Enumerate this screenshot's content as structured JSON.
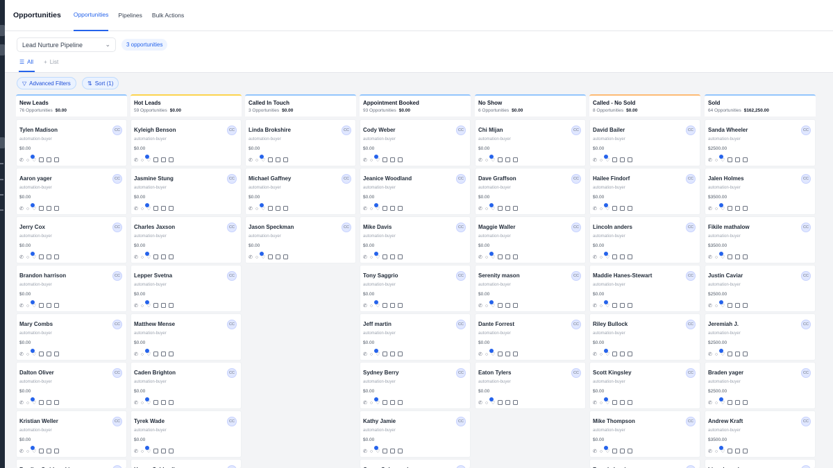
{
  "header": {
    "title": "Opportunities",
    "tabs": [
      {
        "label": "Opportunities",
        "active": true
      },
      {
        "label": "Pipelines",
        "active": false
      },
      {
        "label": "Bulk Actions",
        "active": false
      }
    ]
  },
  "toolbar": {
    "pipeline_select": "Lead Nurture Pipeline",
    "opportunities_count": "3 opportunities",
    "view_tabs": [
      {
        "label": "All",
        "icon": "list-icon",
        "active": true
      },
      {
        "label": "List",
        "icon": "plus-icon",
        "active": false
      }
    ]
  },
  "filters": {
    "advanced_filters": "Advanced Filters",
    "sort": "Sort (1)"
  },
  "card_common": {
    "tag": "automation-buyer",
    "avatar": "CC",
    "action_icons": [
      "phone-icon",
      "chat-icon",
      "tag-icon",
      "document-icon",
      "checkbox-icon",
      "calendar-icon"
    ]
  },
  "columns": [
    {
      "title": "New Leads",
      "count": "76 Opportunities",
      "amount": "$0.00",
      "accent": "#93c5fd",
      "cards": [
        {
          "name": "Tylen Madison",
          "value": "$0.00"
        },
        {
          "name": "Aaron yager",
          "value": "$0.00"
        },
        {
          "name": "Jerry Cox",
          "value": "$0.00"
        },
        {
          "name": "Brandon harrison",
          "value": "$0.00"
        },
        {
          "name": "Mary Combs",
          "value": "$0.00"
        },
        {
          "name": "Dalton Oliver",
          "value": "$0.00"
        },
        {
          "name": "Kristian Weller",
          "value": "$0.00"
        },
        {
          "name": "Bradley Swidowski",
          "value": ""
        }
      ]
    },
    {
      "title": "Hot Leads",
      "count": "59 Opportunities",
      "amount": "$0.00",
      "accent": "#fcd34d",
      "cards": [
        {
          "name": "Kyleigh Benson",
          "value": "$0.00"
        },
        {
          "name": "Jasmine Stung",
          "value": "$0.00"
        },
        {
          "name": "Charles Jaxson",
          "value": "$0.00"
        },
        {
          "name": "Lepper Svetna",
          "value": "$0.00"
        },
        {
          "name": "Matthew Mense",
          "value": "$0.00"
        },
        {
          "name": "Caden Brighton",
          "value": "$0.00"
        },
        {
          "name": "Tyrek Wade",
          "value": "$0.00"
        },
        {
          "name": "Hosea Caldwell",
          "value": ""
        }
      ]
    },
    {
      "title": "Called In Touch",
      "count": "3 Opportunities",
      "amount": "$0.00",
      "accent": "#93c5fd",
      "cards": [
        {
          "name": "Linda Brokshire",
          "value": "$0.00"
        },
        {
          "name": "Michael Gaffney",
          "value": "$0.00"
        },
        {
          "name": "Jason Speckman",
          "value": "$0.00"
        }
      ]
    },
    {
      "title": "Appointment Booked",
      "count": "93 Opportunities",
      "amount": "$0.00",
      "accent": "#93c5fd",
      "cards": [
        {
          "name": "Cody Weber",
          "value": "$0.00"
        },
        {
          "name": "Jeanice Woodland",
          "value": "$0.00"
        },
        {
          "name": "Mike Davis",
          "value": "$0.00"
        },
        {
          "name": "Tony Saggrio",
          "value": "$0.00"
        },
        {
          "name": "Jeff martin",
          "value": "$0.00"
        },
        {
          "name": "Sydney Berry",
          "value": "$0.00"
        },
        {
          "name": "Kathy Jamie",
          "value": "$0.00"
        },
        {
          "name": "Casey Colagrande",
          "value": ""
        }
      ]
    },
    {
      "title": "No Show",
      "count": "6 Opportunities",
      "amount": "$0.00",
      "accent": "#93c5fd",
      "cards": [
        {
          "name": "Chi Mijan",
          "value": "$0.00"
        },
        {
          "name": "Dave Graffson",
          "value": "$0.00"
        },
        {
          "name": "Maggie Waller",
          "value": "$0.00"
        },
        {
          "name": "Serenity mason",
          "value": "$0.00"
        },
        {
          "name": "Dante Forrest",
          "value": "$0.00"
        },
        {
          "name": "Eaton Tylers",
          "value": "$0.00"
        }
      ]
    },
    {
      "title": "Called - No Sold",
      "count": "8 Opportunities",
      "amount": "$0.00",
      "accent": "#fdba74",
      "cards": [
        {
          "name": "David Bailer",
          "value": "$0.00"
        },
        {
          "name": "Hailee Findorf",
          "value": "$0.00"
        },
        {
          "name": "Lincoln anders",
          "value": "$0.00"
        },
        {
          "name": "Maddie Hanes-Stewart",
          "value": "$0.00"
        },
        {
          "name": "Riley Bullock",
          "value": "$0.00"
        },
        {
          "name": "Scott Kingsley",
          "value": "$0.00"
        },
        {
          "name": "Mike Thompson",
          "value": "$0.00"
        },
        {
          "name": "Brenda Lewis",
          "value": ""
        }
      ]
    },
    {
      "title": "Sold",
      "count": "64 Opportunities",
      "amount": "$162,250.00",
      "accent": "#93c5fd",
      "cards": [
        {
          "name": "Sanda Wheeler",
          "value": "$2500.00"
        },
        {
          "name": "Jalen Holmes",
          "value": "$3500.00"
        },
        {
          "name": "Fikile mathalow",
          "value": "$3500.00"
        },
        {
          "name": "Justin Caviar",
          "value": "$2500.00"
        },
        {
          "name": "Jeremiah J.",
          "value": "$2500.00"
        },
        {
          "name": "Braden yager",
          "value": "$2500.00"
        },
        {
          "name": "Andrew Kraft",
          "value": "$3500.00"
        },
        {
          "name": "Lincoln anders",
          "value": ""
        }
      ]
    }
  ]
}
